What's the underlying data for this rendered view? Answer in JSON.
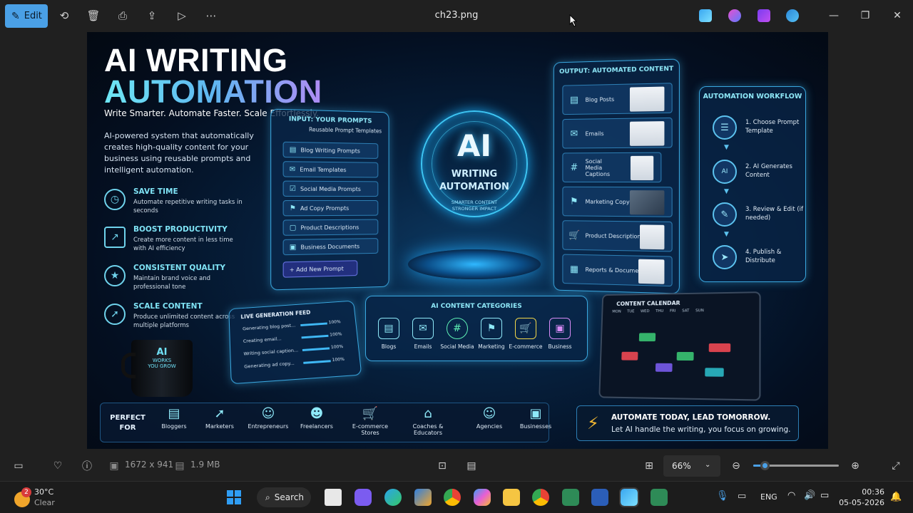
{
  "toolbar": {
    "edit_label": "Edit",
    "filename": "ch23.png",
    "icons": [
      "rotate-icon",
      "delete-icon",
      "print-icon",
      "share-icon",
      "slideshow-icon",
      "more-icon"
    ]
  },
  "poster": {
    "title_line1": "AI WRITING",
    "title_line2": "AUTOMATION",
    "tagline": "Write Smarter. Automate Faster. Scale Effortlessly.",
    "description": "AI-powered system that automatically creates high-quality content for your business using reusable prompts and intelligent automation.",
    "features": [
      {
        "title": "SAVE TIME",
        "desc": "Automate repetitive writing tasks in seconds"
      },
      {
        "title": "BOOST PRODUCTIVITY",
        "desc": "Create more content in less time with AI efficiency"
      },
      {
        "title": "CONSISTENT QUALITY",
        "desc": "Maintain brand voice and professional tone"
      },
      {
        "title": "SCALE CONTENT",
        "desc": "Produce unlimited content across multiple platforms"
      }
    ],
    "input_panel": {
      "title": "INPUT: YOUR PROMPTS",
      "subtitle": "Reusable Prompt Templates",
      "items": [
        "Blog Writing Prompts",
        "Email Templates",
        "Social Media Prompts",
        "Ad Copy Prompts",
        "Product Descriptions",
        "Business Documents"
      ],
      "add_label": "+ Add New Prompt"
    },
    "hub": {
      "big": "AI",
      "line1": "WRITING",
      "line2": "AUTOMATION",
      "sub1": "SMARTER CONTENT",
      "sub2": "STRONGER IMPACT"
    },
    "output_panel": {
      "title": "OUTPUT: AUTOMATED CONTENT",
      "items": [
        "Blog Posts",
        "Emails",
        "Social Media Captions",
        "Marketing Copy",
        "Product Descriptions",
        "Reports & Documents"
      ]
    },
    "workflow": {
      "title": "AUTOMATION WORKFLOW",
      "steps": [
        "1. Choose Prompt Template",
        "2. AI Generates Content",
        "3. Review & Edit (if needed)",
        "4. Publish & Distribute"
      ]
    },
    "feed": {
      "title": "LIVE GENERATION FEED",
      "rows": [
        {
          "label": "Generating blog post...",
          "pct": "100%"
        },
        {
          "label": "Creating email...",
          "pct": "100%"
        },
        {
          "label": "Writing social caption...",
          "pct": "100%"
        },
        {
          "label": "Generating ad copy...",
          "pct": "100%"
        }
      ]
    },
    "mug": {
      "line1": "AI",
      "line2": "WORKS",
      "line3": "YOU GROW"
    },
    "categories": {
      "title": "AI CONTENT CATEGORIES",
      "items": [
        "Blogs",
        "Emails",
        "Social Media",
        "Marketing",
        "E-commerce",
        "Business"
      ]
    },
    "calendar": {
      "title": "CONTENT CALENDAR",
      "days": [
        "MON",
        "TUE",
        "WED",
        "THU",
        "FRI",
        "SAT",
        "SUN"
      ]
    },
    "perfect_for": {
      "label": "PERFECT FOR",
      "items": [
        "Bloggers",
        "Marketers",
        "Entrepreneurs",
        "Freelancers",
        "E-commerce Stores",
        "Coaches & Educators",
        "Agencies",
        "Businesses"
      ]
    },
    "cta": {
      "line1": "AUTOMATE TODAY, LEAD TOMORROW.",
      "line2": "Let AI handle the writing, you focus on growing."
    }
  },
  "infobar": {
    "dimensions": "1672 x 941",
    "filesize": "1.9 MB",
    "zoom": "66%",
    "zoom_fraction": 0.13
  },
  "taskbar": {
    "weather_temp": "30°C",
    "weather_desc": "Clear",
    "weather_badge": "2",
    "search_label": "Search",
    "lang": "ENG",
    "time": "00:36",
    "date": "05-05-2026"
  }
}
